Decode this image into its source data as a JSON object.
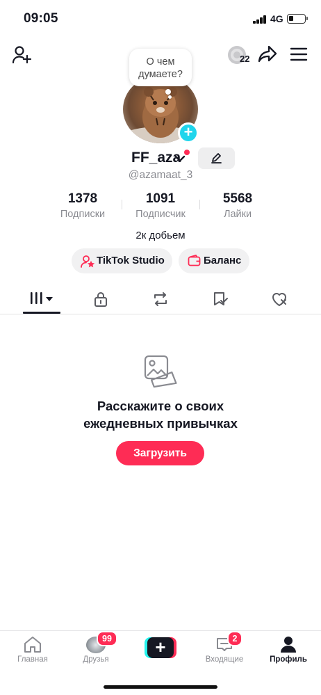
{
  "status_bar": {
    "time": "09:05",
    "network": "4G",
    "battery_level": 0.3
  },
  "top_bar": {
    "add_friend_icon": "person-add-icon",
    "coin_icon": "coin-icon",
    "coin_count": "22",
    "share_icon": "share-arrow-icon",
    "menu_icon": "hamburger-menu-icon"
  },
  "profile": {
    "thought_bubble": "О чем думаете?",
    "username": "FF_aza",
    "handle": "@azamaat_3",
    "bio": "2к добьем",
    "stats": [
      {
        "value": "1378",
        "label": "Подписки"
      },
      {
        "value": "1091",
        "label": "Подписчик"
      },
      {
        "value": "5568",
        "label": "Лайки"
      }
    ],
    "buttons": {
      "studio": "TikTok Studio",
      "balance": "Баланс"
    }
  },
  "tabs": [
    {
      "icon": "grid-videos-icon",
      "active": true
    },
    {
      "icon": "lock-icon",
      "active": false
    },
    {
      "icon": "repost-icon",
      "active": false
    },
    {
      "icon": "bookmark-icon",
      "active": false
    },
    {
      "icon": "liked-heart-icon",
      "active": false
    }
  ],
  "empty_state": {
    "title_line1": "Расскажите о своих",
    "title_line2": "ежедневных привычках",
    "upload_label": "Загрузить"
  },
  "bottom_nav": {
    "home": "Главная",
    "friends": "Друзья",
    "friends_badge": "99",
    "inbox": "Входящие",
    "inbox_badge": "2",
    "profile": "Профиль",
    "create_label": "+"
  },
  "colors": {
    "accent": "#fe2c55",
    "cyan": "#20d5ec",
    "text": "#161823",
    "muted": "#8a8b91"
  }
}
